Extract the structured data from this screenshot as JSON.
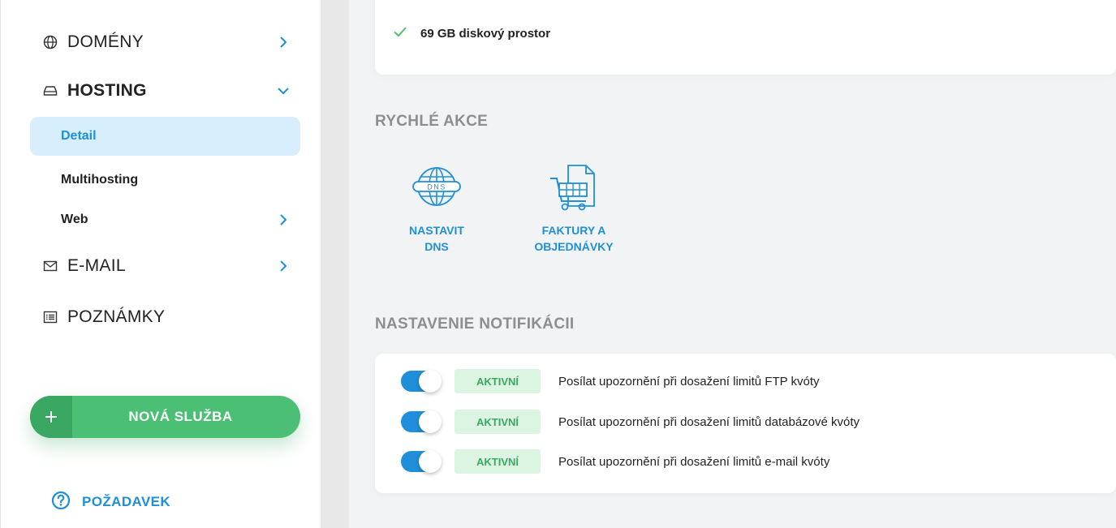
{
  "sidebar": {
    "domains_label": "DOMÉNY",
    "hosting_label": "HOSTING",
    "hosting_sub": [
      "Detail",
      "Multihosting",
      "Web"
    ],
    "email_label": "E-MAIL",
    "notes_label": "POZNÁMKY",
    "new_service_label": "NOVÁ SLUŽBA",
    "request_label": "POŽADAVEK",
    "icons": {
      "domains": "globe-icon",
      "hosting": "hard-drive-icon",
      "email": "envelope-icon",
      "notes": "list-icon",
      "new_service": "plus-icon",
      "request": "question-circle-icon"
    }
  },
  "main": {
    "disk_space": "69 GB diskový prostor",
    "quick_actions": {
      "title": "RYCHLÉ AKCE",
      "items": [
        {
          "label": "NASTAVIT\nDNS",
          "icon": "dns-globe-icon",
          "icon_text": "DNS"
        },
        {
          "label": "FAKTURY A\nOBJEDNÁVKY",
          "icon": "cart-invoice-icon"
        }
      ]
    },
    "notifications": {
      "title": "NASTAVENIE NOTIFIKÁCII",
      "rows": [
        {
          "status": "AKTIVNÍ",
          "enabled": true,
          "text": "Posílat upozornění při dosažení limitů FTP kvóty"
        },
        {
          "status": "AKTIVNÍ",
          "enabled": true,
          "text": "Posílat upozornění při dosažení limitů databázové kvóty"
        },
        {
          "status": "AKTIVNÍ",
          "enabled": true,
          "text": "Posílat upozornění při dosažení limitů e-mail kvóty"
        }
      ]
    }
  },
  "colors": {
    "accent": "#1e8fd8",
    "success": "#4bbf73",
    "active_bg": "#d7eefc",
    "badge_bg": "#dcf5e3",
    "section_title": "#8e8e8e"
  }
}
